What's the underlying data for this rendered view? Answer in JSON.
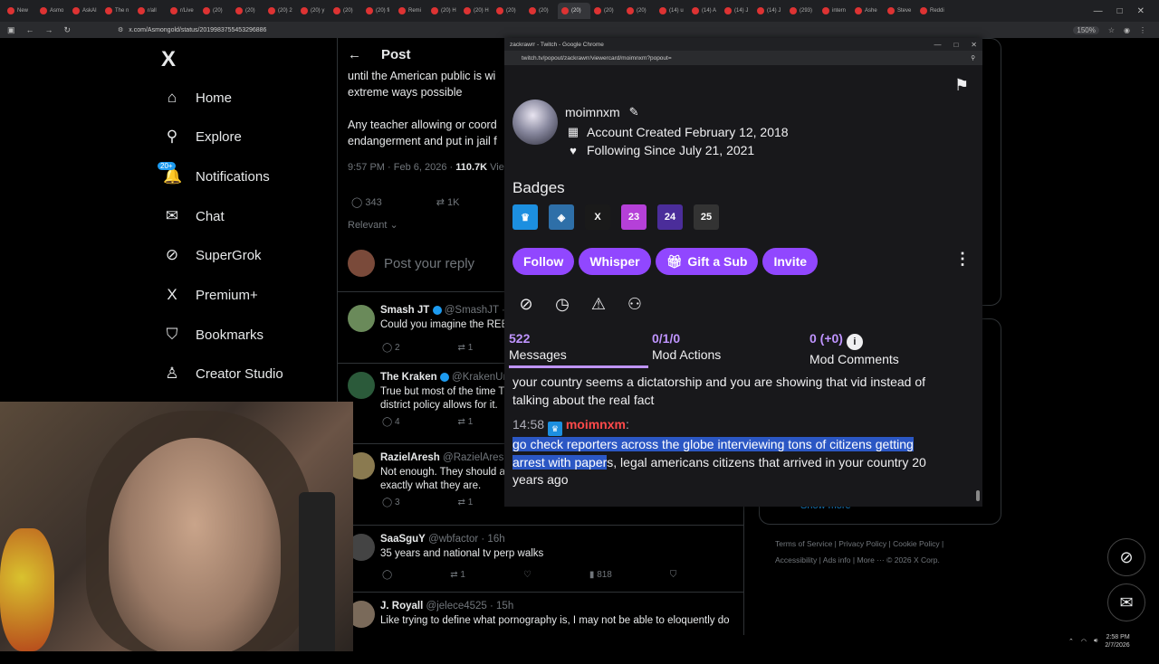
{
  "browser": {
    "tabs": [
      "New",
      "Asmo",
      "AskAI",
      "The n",
      "r/all",
      "r/Live",
      "(20)",
      "(20)",
      "(20) 2",
      "(20) y",
      "(20)",
      "(20) fi",
      "Remi",
      "(20) H",
      "(20) H",
      "(20)",
      "(20)",
      "(20)",
      "(20)",
      "(20)",
      "(14) u",
      "(14) A",
      "(14) J",
      "(14) J",
      "(293)",
      "intern",
      "Ashe",
      "Steve",
      "Reddi"
    ],
    "url": "x.com/Asmongold/status/2019983755453296886",
    "zoom": "150%"
  },
  "x_sidebar": {
    "logo": "X",
    "notif_count": "20+",
    "items": [
      {
        "label": "Home",
        "icon": "⌂"
      },
      {
        "label": "Explore",
        "icon": "⚲"
      },
      {
        "label": "Notifications",
        "icon": "🔔"
      },
      {
        "label": "Chat",
        "icon": "✉"
      },
      {
        "label": "SuperGrok",
        "icon": "⊘"
      },
      {
        "label": "Premium+",
        "icon": "X"
      },
      {
        "label": "Bookmarks",
        "icon": "⛉"
      },
      {
        "label": "Creator Studio",
        "icon": "♙"
      }
    ]
  },
  "post": {
    "header": "Post",
    "lines": [
      "until the American public is wi",
      "extreme ways possible",
      "Any teacher allowing or coord",
      "endangerment and put in jail f"
    ],
    "time": "9:57 PM · Feb 6, 2026 · ",
    "views": "110.7K",
    "views_label": "Views",
    "replies": "343",
    "reposts": "1K",
    "sort": "Relevant",
    "reply_placeholder": "Post your reply"
  },
  "tweets": [
    {
      "name": "Smash JT",
      "handle": "@SmashJT · ",
      "body": [
        "Could you imagine the REE"
      ],
      "replies": "2",
      "reposts": "1",
      "likes": "",
      "views": ""
    },
    {
      "name": "The Kraken",
      "handle": "@KrakenUn",
      "body": [
        "True but most of the time T",
        "district policy allows for it."
      ],
      "replies": "4",
      "reposts": "1",
      "likes": "",
      "views": ""
    },
    {
      "name": "RazielAresh",
      "handle": "@RazielAresh",
      "body": [
        "Not enough. They should a",
        "exactly what they are."
      ],
      "replies": "3",
      "reposts": "1",
      "likes": "5",
      "views": "1.4K"
    },
    {
      "name": "SaaSguY",
      "handle": "@wbfactor · 16h",
      "body": [
        "35 years and national tv perp walks"
      ],
      "replies": "",
      "reposts": "1",
      "likes": "",
      "views": "818"
    },
    {
      "name": "J. Royall",
      "handle": "@jelece4525 · 15h",
      "body": [
        "Like trying to define what pornography is, I may not be able to eloquently do"
      ],
      "replies": "",
      "reposts": "",
      "likes": "",
      "views": ""
    }
  ],
  "right": {
    "show_more": "Show more",
    "footer1": [
      "Terms of Service",
      "|",
      "Privacy Policy",
      "|",
      "Cookie Policy",
      "|"
    ],
    "footer2": [
      "Accessibility",
      "|",
      "Ads info",
      "|",
      "More ···",
      "© 2026 X Corp."
    ]
  },
  "popout": {
    "window_title": "zackrawrr - Twitch - Google Chrome",
    "url": "twitch.tv/popout/zackrawrr/viewercard/moimnxm?popout=",
    "username": "moimnxm",
    "created": "Account Created February 12, 2018",
    "following": "Following Since July 21, 2021",
    "badges_heading": "Badges",
    "badges": [
      {
        "label": "♛",
        "color": "#1c8fe0"
      },
      {
        "label": "◈",
        "color": "#2e6fa8"
      },
      {
        "label": "X",
        "color": "#1a1a1a"
      },
      {
        "label": "23",
        "color": "#b540d8"
      },
      {
        "label": "24",
        "color": "#4b2d9a"
      },
      {
        "label": "25",
        "color": "#333333"
      }
    ],
    "buttons": {
      "follow": "Follow",
      "whisper": "Whisper",
      "gift": "Gift a Sub",
      "invite": "Invite"
    },
    "stats": [
      {
        "n": "522",
        "label": "Messages"
      },
      {
        "n": "0/1/0",
        "label": "Mod Actions"
      },
      {
        "n": "0 (+0)",
        "label": "Mod Comments"
      }
    ],
    "chat_prev": [
      "your country seems a dictatorship and you are showing that vid instead of",
      "talking about the real fact"
    ],
    "chat_time": "14:58",
    "chat_user": "moimnxm",
    "chat_hl1": "go check reporters across the globe interviewing tons of citizens getting",
    "chat_hl2": "arrest with paper",
    "chat_rest2": "s, legal americans citizens that arrived in your country 20",
    "chat_rest3": "years ago"
  },
  "taskbar": {
    "time": "2:58 PM",
    "date": "2/7/2026"
  }
}
